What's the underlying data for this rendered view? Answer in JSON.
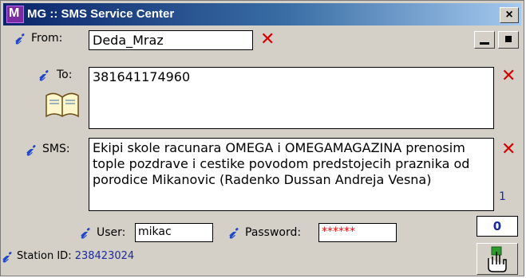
{
  "window": {
    "title": "MG :: SMS Service Center",
    "close_label": "×"
  },
  "from": {
    "label": "From:",
    "value": "Deda_Mraz"
  },
  "to": {
    "label": "To:",
    "value": "381641174960"
  },
  "sms": {
    "label": "SMS:",
    "value": "Ekipi skole racunara OMEGA i OMEGAMAGAZINA prenosim tople pozdrave i cestike povodom predstojecih praznika od porodice Mikanovic (Radenko Dussan Andreja Vesna)",
    "count": "1"
  },
  "user": {
    "label": "User:",
    "value": "mikac"
  },
  "password": {
    "label": "Password:",
    "value": "******"
  },
  "counter": {
    "value": "0"
  },
  "station": {
    "label": "Station ID:",
    "value": "238423024"
  },
  "icons": {
    "info": "info-icon",
    "clear": "clear-x-icon",
    "addressbook": "address-book-icon",
    "send": "send-hand-icon"
  },
  "colors": {
    "title_start": "#0a246a",
    "title_end": "#a6caf0",
    "accent_blue": "#1a2a9c",
    "clear_red": "#d40000",
    "password_text": "#ff0000"
  }
}
